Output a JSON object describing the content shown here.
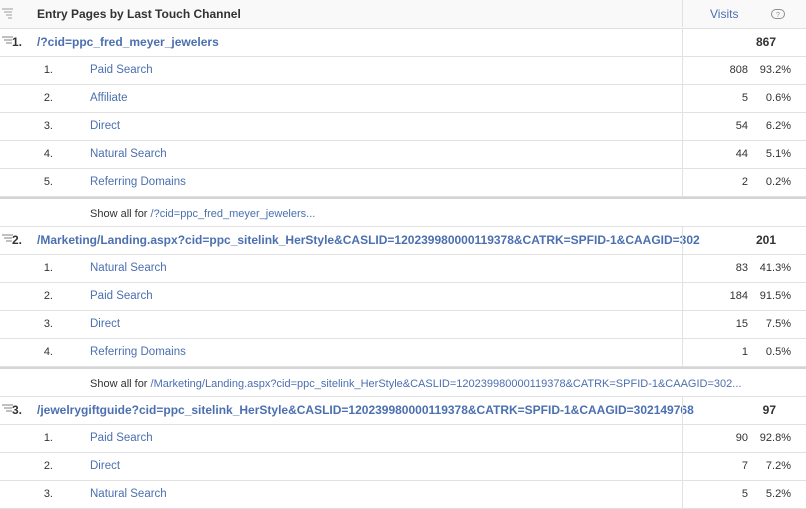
{
  "header": {
    "title": "Entry Pages by Last Touch Channel",
    "metric": "Visits"
  },
  "groups": [
    {
      "num": "1.",
      "page": "/?cid=ppc_fred_meyer_jewelers",
      "visits": "867",
      "rows": [
        {
          "num": "1.",
          "channel": "Paid Search",
          "visits": "808",
          "pct": "93.2%"
        },
        {
          "num": "2.",
          "channel": "Affiliate",
          "visits": "5",
          "pct": "0.6%"
        },
        {
          "num": "3.",
          "channel": "Direct",
          "visits": "54",
          "pct": "6.2%"
        },
        {
          "num": "4.",
          "channel": "Natural Search",
          "visits": "44",
          "pct": "5.1%"
        },
        {
          "num": "5.",
          "channel": "Referring Domains",
          "visits": "2",
          "pct": "0.2%"
        }
      ],
      "show_all_prefix": "Show all for",
      "show_all_link": "/?cid=ppc_fred_meyer_jewelers..."
    },
    {
      "num": "2.",
      "page": "/Marketing/Landing.aspx?cid=ppc_sitelink_HerStyle&CASLID=120239980000119378&CATRK=SPFID-1&CAAGID=302",
      "visits": "201",
      "rows": [
        {
          "num": "1.",
          "channel": "Natural Search",
          "visits": "83",
          "pct": "41.3%"
        },
        {
          "num": "2.",
          "channel": "Paid Search",
          "visits": "184",
          "pct": "91.5%"
        },
        {
          "num": "3.",
          "channel": "Direct",
          "visits": "15",
          "pct": "7.5%"
        },
        {
          "num": "4.",
          "channel": "Referring Domains",
          "visits": "1",
          "pct": "0.5%"
        }
      ],
      "show_all_prefix": "Show all for",
      "show_all_link": "/Marketing/Landing.aspx?cid=ppc_sitelink_HerStyle&CASLID=120239980000119378&CATRK=SPFID-1&CAAGID=302..."
    },
    {
      "num": "3.",
      "page": "/jewelrygiftguide?cid=ppc_sitelink_HerStyle&CASLID=120239980000119378&CATRK=SPFID-1&CAAGID=302149768",
      "visits": "97",
      "rows": [
        {
          "num": "1.",
          "channel": "Paid Search",
          "visits": "90",
          "pct": "92.8%"
        },
        {
          "num": "2.",
          "channel": "Direct",
          "visits": "7",
          "pct": "7.2%"
        },
        {
          "num": "3.",
          "channel": "Natural Search",
          "visits": "5",
          "pct": "5.2%"
        }
      ]
    }
  ]
}
